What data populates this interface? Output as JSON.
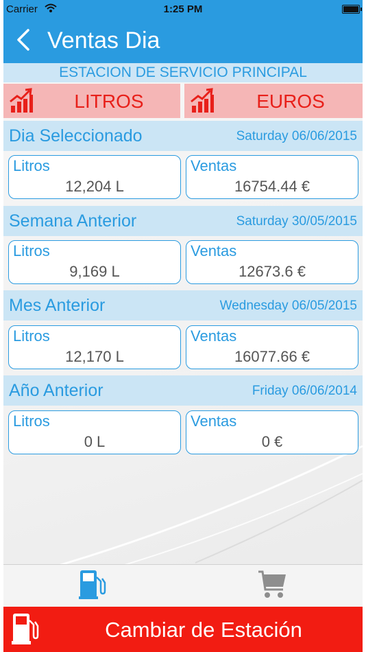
{
  "status_bar": {
    "carrier": "Carrier",
    "time": "1:25 PM"
  },
  "nav": {
    "back_icon": "chevron-left-icon",
    "title": "Ventas Dia"
  },
  "station": {
    "name": "ESTACION DE SERVICIO PRINCIPAL"
  },
  "tabs": [
    {
      "label": "LITROS",
      "icon": "chart-up-icon"
    },
    {
      "label": "EUROS",
      "icon": "chart-up-icon"
    }
  ],
  "sections": [
    {
      "title": "Dia Seleccionado",
      "date": "Saturday 06/06/2015",
      "litros_label": "Litros",
      "litros_value": "12,204 L",
      "ventas_label": "Ventas",
      "ventas_value": "16754.44 €"
    },
    {
      "title": "Semana Anterior",
      "date": "Saturday 30/05/2015",
      "litros_label": "Litros",
      "litros_value": "9,169 L",
      "ventas_label": "Ventas",
      "ventas_value": "12673.6 €"
    },
    {
      "title": "Mes Anterior",
      "date": "Wednesday 06/05/2015",
      "litros_label": "Litros",
      "litros_value": "12,170 L",
      "ventas_label": "Ventas",
      "ventas_value": "16077.66 €"
    },
    {
      "title": "Año Anterior",
      "date": "Friday 06/06/2014",
      "litros_label": "Litros",
      "litros_value": "0 L",
      "ventas_label": "Ventas",
      "ventas_value": "0 €"
    }
  ],
  "tabbar": [
    {
      "icon": "fuel-pump-icon",
      "selected": true
    },
    {
      "icon": "shopping-cart-icon",
      "selected": false
    }
  ],
  "change_station": {
    "label": "Cambiar de Estación",
    "icon": "fuel-pump-icon"
  },
  "colors": {
    "accent": "#2a9be0",
    "red": "#f21c12",
    "tab_bg": "#f5b6b6",
    "section_bg": "#cbe5f5"
  }
}
